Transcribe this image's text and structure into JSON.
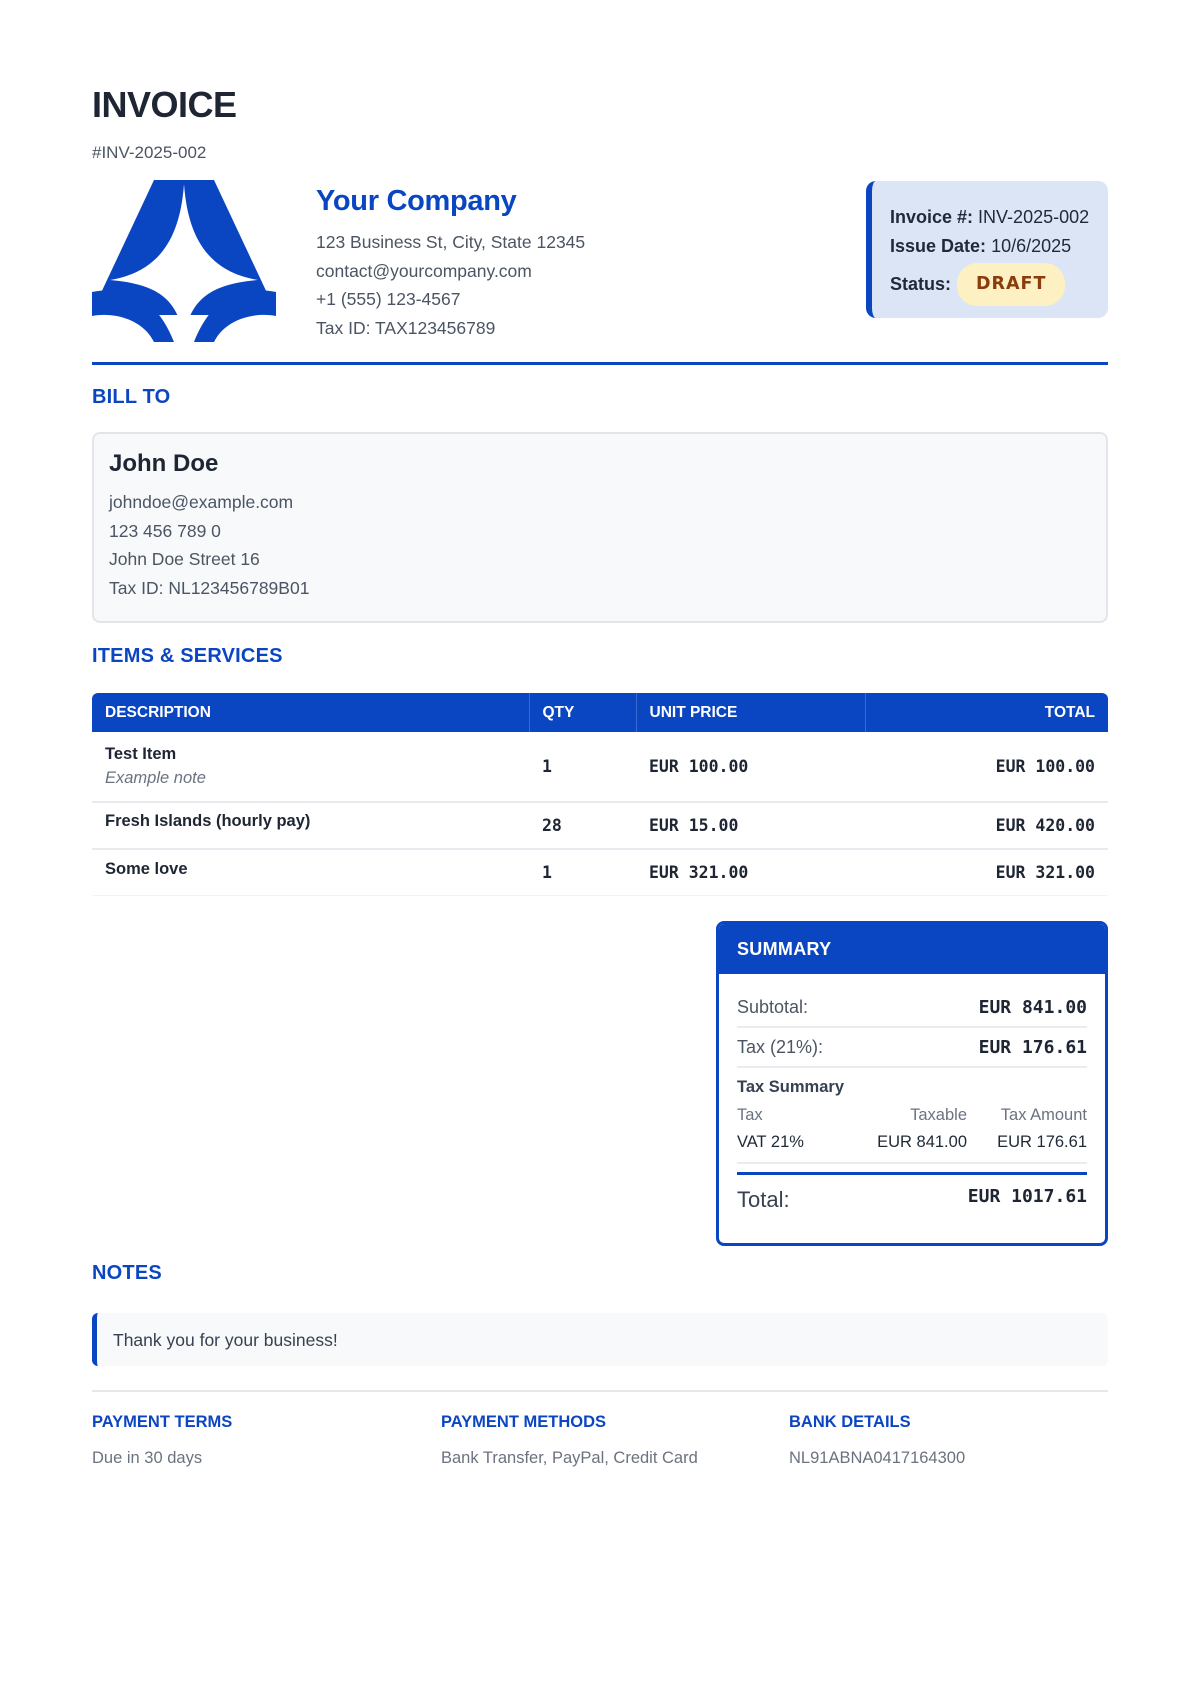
{
  "header": {
    "title": "INVOICE",
    "number": "#INV-2025-002"
  },
  "company": {
    "name": "Your Company",
    "address": "123 Business St, City, State 12345",
    "email": "contact@yourcompany.com",
    "phone": "+1 (555) 123-4567",
    "tax_id": "Tax ID: TAX123456789"
  },
  "meta": {
    "invoice_label": "Invoice #:",
    "invoice_value": "INV-2025-002",
    "date_label": "Issue Date:",
    "date_value": "10/6/2025",
    "status_label": "Status:",
    "status_value": "DRAFT"
  },
  "bill_to": {
    "title": "BILL TO",
    "name": "John Doe",
    "email": "johndoe@example.com",
    "phone": "123 456 789 0",
    "street": "John Doe Street 16",
    "tax_id": "Tax ID: NL123456789B01"
  },
  "items": {
    "title": "ITEMS & SERVICES",
    "columns": [
      "DESCRIPTION",
      "QTY",
      "UNIT PRICE",
      "TOTAL"
    ],
    "rows": [
      {
        "description": "Test Item",
        "note": "Example note",
        "qty": "1",
        "unit_price": "EUR 100.00",
        "total": "EUR 100.00"
      },
      {
        "description": "Fresh Islands (hourly pay)",
        "note": "",
        "qty": "28",
        "unit_price": "EUR 15.00",
        "total": "EUR 420.00"
      },
      {
        "description": "Some love",
        "note": "",
        "qty": "1",
        "unit_price": "EUR 321.00",
        "total": "EUR 321.00"
      }
    ]
  },
  "summary": {
    "title": "SUMMARY",
    "subtotal_label": "Subtotal:",
    "subtotal_value": "EUR 841.00",
    "tax_label": "Tax (21%):",
    "tax_value": "EUR 176.61",
    "tax_summary_title": "Tax Summary",
    "tax_columns": [
      "Tax",
      "Taxable",
      "Tax Amount"
    ],
    "tax_row": [
      "VAT 21%",
      "EUR 841.00",
      "EUR 176.61"
    ],
    "total_label": "Total:",
    "total_value": "EUR 1017.61"
  },
  "notes": {
    "title": "NOTES",
    "text": "Thank you for your business!"
  },
  "footer": {
    "terms_title": "PAYMENT TERMS",
    "terms_text": "Due in 30 days",
    "methods_title": "PAYMENT METHODS",
    "methods_text": "Bank Transfer, PayPal, Credit Card",
    "bank_title": "BANK DETAILS",
    "bank_text": "NL91ABNA0417164300"
  },
  "colors": {
    "brand": "#0b46c2",
    "status_bg": "#fdf0c2",
    "status_text": "#8a3c0c"
  },
  "icons": {
    "logo": "star-triangle-logo-icon"
  }
}
